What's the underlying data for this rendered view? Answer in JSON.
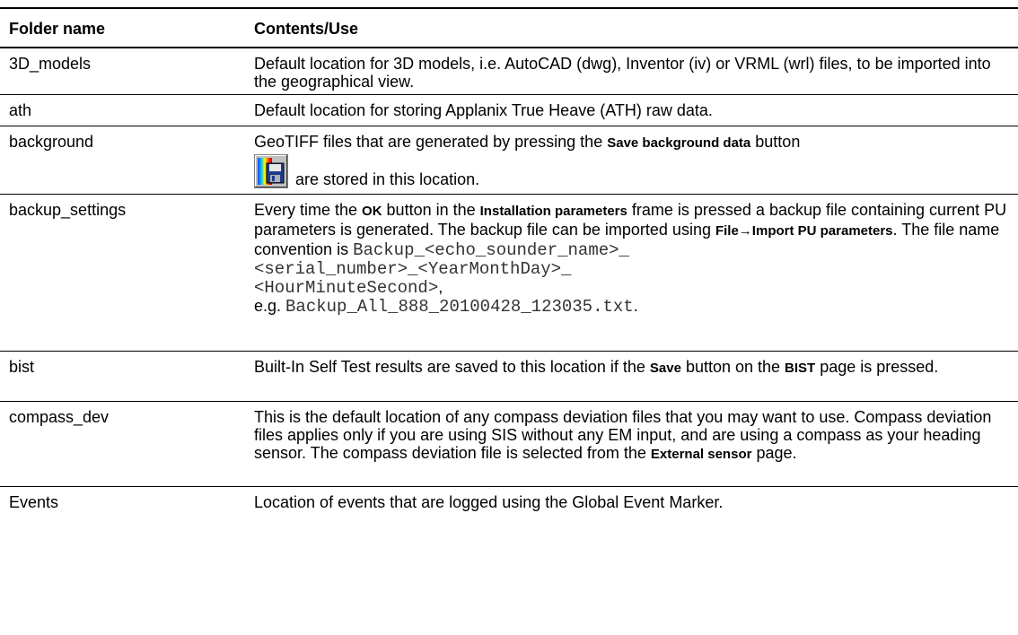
{
  "header": {
    "col1": "Folder name",
    "col2": "Contents/Use"
  },
  "rows": {
    "models": {
      "name": "3D_models",
      "text": "Default location for 3D models, i.e. AutoCAD (dwg), Inventor (iv) or VRML (wrl) files, to be imported into the geographical view."
    },
    "ath": {
      "name": "ath",
      "text": "Default location for storing Applanix True Heave (ATH) raw data."
    },
    "background": {
      "name": "background",
      "t1": "GeoTIFF files that are generated by pressing the ",
      "b1": "Save background data",
      "t2": " button",
      "t3": "are stored in this location.",
      "icon": "save-background-data-icon"
    },
    "backup": {
      "name": "backup_settings",
      "t1": "Every time the ",
      "b1": "OK",
      "t2": " button in the ",
      "b2": "Installation parameters",
      "t3": " frame is pressed a backup file containing current PU parameters is generated.  The backup file can be imported using ",
      "b3": "File→Import PU parameters",
      "t4": ".  The file name convention is ",
      "m1": "Backup_<echo_sounder_name>_",
      "m2": "<serial_number>_<YearMonthDay>_",
      "m3": "<HourMinuteSecond>",
      "t5": ",",
      "t6": "e.g. ",
      "m4": "Backup_All_888_20100428_123035.txt",
      "t7": "."
    },
    "bist": {
      "name": "bist",
      "t1": "Built-In Self Test results are saved to this location if the ",
      "b1": "Save",
      "t2": " button on the ",
      "b2": "BIST",
      "t3": " page is pressed."
    },
    "compass": {
      "name": "compass_dev",
      "t1": "This is the default location of any compass deviation files that you may want to use. Compass deviation files applies only if you are using SIS without any EM input, and are using a compass as your heading sensor. The compass deviation file is selected from the ",
      "b1": "External sensor",
      "t2": " page."
    },
    "events": {
      "name": "Events",
      "text": "Location of events that are logged using the Global Event Marker."
    }
  }
}
